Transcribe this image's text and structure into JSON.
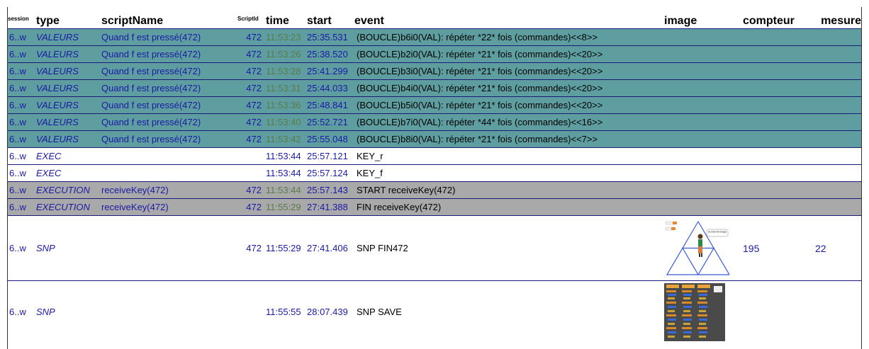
{
  "headers": {
    "session": "session",
    "type": "type",
    "scriptName": "scriptName",
    "scriptId": "ScriptId",
    "time": "time",
    "start": "start",
    "event": "event",
    "image": "image",
    "compteur": "compteur",
    "mesure": "mesure"
  },
  "rows": [
    {
      "session": "6..w",
      "type": "VALEURS",
      "scriptName": "Quand f est pressé(472)",
      "scriptId": "472",
      "time": "11:53:23",
      "start": "25:35.531",
      "event": "(BOUCLE)b6i0(VAL): répéter *22* fois (commandes)<<8>>"
    },
    {
      "session": "6..w",
      "type": "VALEURS",
      "scriptName": "Quand f est pressé(472)",
      "scriptId": "472",
      "time": "11:53:26",
      "start": "25:38.520",
      "event": "(BOUCLE)b2i0(VAL): répéter *21* fois (commandes)<<20>>"
    },
    {
      "session": "6..w",
      "type": "VALEURS",
      "scriptName": "Quand f est pressé(472)",
      "scriptId": "472",
      "time": "11:53:28",
      "start": "25:41.299",
      "event": "(BOUCLE)b3i0(VAL): répéter *21* fois (commandes)<<20>>"
    },
    {
      "session": "6..w",
      "type": "VALEURS",
      "scriptName": "Quand f est pressé(472)",
      "scriptId": "472",
      "time": "11:53:31",
      "start": "25:44.033",
      "event": "(BOUCLE)b4i0(VAL): répéter *21* fois (commandes)<<20>>"
    },
    {
      "session": "6..w",
      "type": "VALEURS",
      "scriptName": "Quand f est pressé(472)",
      "scriptId": "472",
      "time": "11:53:36",
      "start": "25:48.841",
      "event": "(BOUCLE)b5i0(VAL): répéter *21* fois (commandes)<<20>>"
    },
    {
      "session": "6..w",
      "type": "VALEURS",
      "scriptName": "Quand f est pressé(472)",
      "scriptId": "472",
      "time": "11:53:40",
      "start": "25:52.721",
      "event": "(BOUCLE)b7i0(VAL): répéter *44* fois (commandes)<<16>>"
    },
    {
      "session": "6..w",
      "type": "VALEURS",
      "scriptName": "Quand f est pressé(472)",
      "scriptId": "472",
      "time": "11:53:42",
      "start": "25:55.048",
      "event": "(BOUCLE)b8i0(VAL): répéter *21* fois (commandes)<<7>>"
    },
    {
      "session": "6..w",
      "type": "EXEC",
      "scriptName": "",
      "scriptId": "",
      "time": "11:53:44",
      "start": "25:57.121",
      "event": "KEY_r"
    },
    {
      "session": "6..w",
      "type": "EXEC",
      "scriptName": "",
      "scriptId": "",
      "time": "11:53:44",
      "start": "25:57.124",
      "event": "KEY_f"
    },
    {
      "session": "6..w",
      "type": "EXECUTION",
      "scriptName": "receiveKey(472)",
      "scriptId": "472",
      "time": "11:53:44",
      "start": "25:57.143",
      "event": "START receiveKey(472)"
    },
    {
      "session": "6..w",
      "type": "EXECUTION",
      "scriptName": "receiveKey(472)",
      "scriptId": "472",
      "time": "11:55:29",
      "start": "27:41.388",
      "event": "FIN receiveKey(472)"
    },
    {
      "session": "6..w",
      "type": "SNP",
      "scriptName": "",
      "scriptId": "472",
      "time": "11:55:29",
      "start": "27:41.406",
      "event": "SNP FIN472",
      "compteur": "195",
      "mesure": "22",
      "image_caption": "j'ai compté 195 messages"
    },
    {
      "session": "6..w",
      "type": "SNP",
      "scriptName": "",
      "scriptId": "",
      "time": "11:55:55",
      "start": "28:07.439",
      "event": "SNP SAVE",
      "compteur": "",
      "mesure": ""
    }
  ],
  "colors": {
    "valeurs_row": "#5f9ea0",
    "execution_row": "#a9a9a9",
    "link_text": "#1a1aa6"
  }
}
